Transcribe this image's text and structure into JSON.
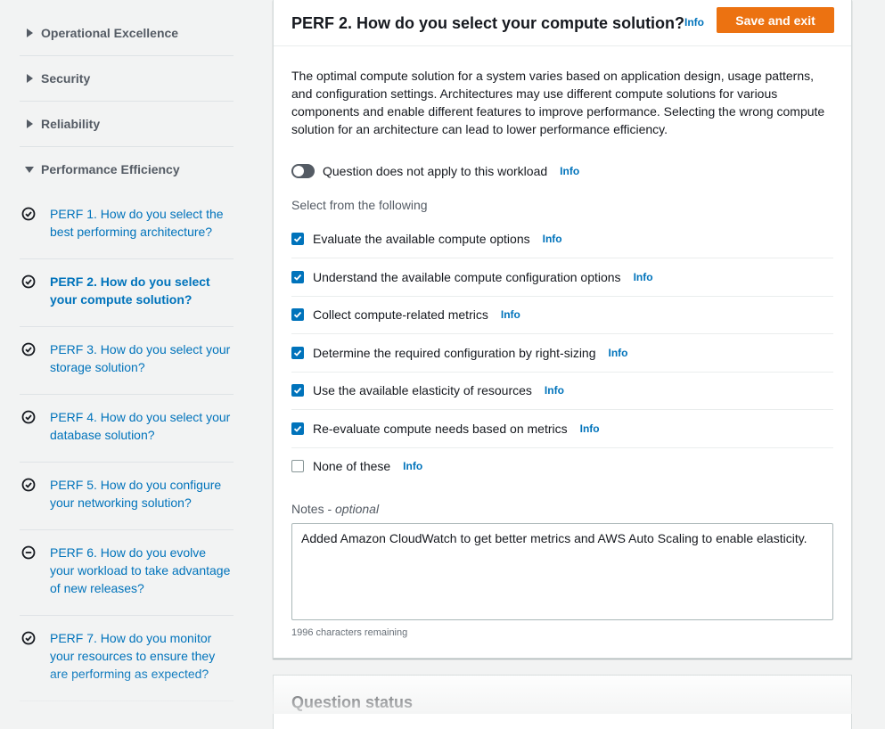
{
  "sidebar": {
    "pillars": [
      {
        "label": "Operational Excellence",
        "expanded": false
      },
      {
        "label": "Security",
        "expanded": false
      },
      {
        "label": "Reliability",
        "expanded": false
      },
      {
        "label": "Performance Efficiency",
        "expanded": true
      }
    ],
    "questions": [
      {
        "label": "PERF 1. How do you select the best performing architecture?",
        "status": "answered",
        "icon": "check-circle-icon"
      },
      {
        "label": "PERF 2. How do you select your compute solution?",
        "status": "answered",
        "icon": "check-circle-icon",
        "active": true
      },
      {
        "label": "PERF 3. How do you select your storage solution?",
        "status": "answered",
        "icon": "check-circle-icon"
      },
      {
        "label": "PERF 4. How do you select your database solution?",
        "status": "answered",
        "icon": "check-circle-icon"
      },
      {
        "label": "PERF 5. How do you configure your networking solution?",
        "status": "answered",
        "icon": "check-circle-icon"
      },
      {
        "label": "PERF 6. How do you evolve your workload to take advantage of new releases?",
        "status": "not-applicable",
        "icon": "minus-circle-icon"
      },
      {
        "label": "PERF 7. How do you monitor your resources to ensure they are performing as expected?",
        "status": "answered",
        "icon": "check-circle-icon"
      }
    ]
  },
  "question": {
    "title": "PERF 2. How do you select your compute solution?",
    "info": "Info",
    "save_label": "Save and exit",
    "description": "The optimal compute solution for a system varies based on application design, usage patterns, and configuration settings. Architectures may use different compute solutions for various components and enable different features to improve performance. Selecting the wrong compute solution for an architecture can lead to lower performance efficiency.",
    "toggle_label": "Question does not apply to this workload",
    "toggle_on": false,
    "select_label": "Select from the following",
    "choices": [
      {
        "label": "Evaluate the available compute options",
        "checked": true
      },
      {
        "label": "Understand the available compute configuration options",
        "checked": true
      },
      {
        "label": "Collect compute-related metrics",
        "checked": true
      },
      {
        "label": "Determine the required configuration by right-sizing",
        "checked": true
      },
      {
        "label": "Use the available elasticity of resources",
        "checked": true
      },
      {
        "label": "Re-evaluate compute needs based on metrics",
        "checked": true
      },
      {
        "label": "None of these",
        "checked": false
      }
    ],
    "notes_label": "Notes - ",
    "notes_optional": "optional",
    "notes_value": "Added Amazon CloudWatch to get better metrics and AWS Auto Scaling to enable elasticity.",
    "remaining": "1996 characters remaining"
  },
  "status_panel": {
    "title": "Question status"
  },
  "colors": {
    "link": "#0073bb",
    "accent": "#ec7211",
    "checkbox": "#0073bb",
    "text": "#16191f",
    "muted": "#545b64"
  }
}
